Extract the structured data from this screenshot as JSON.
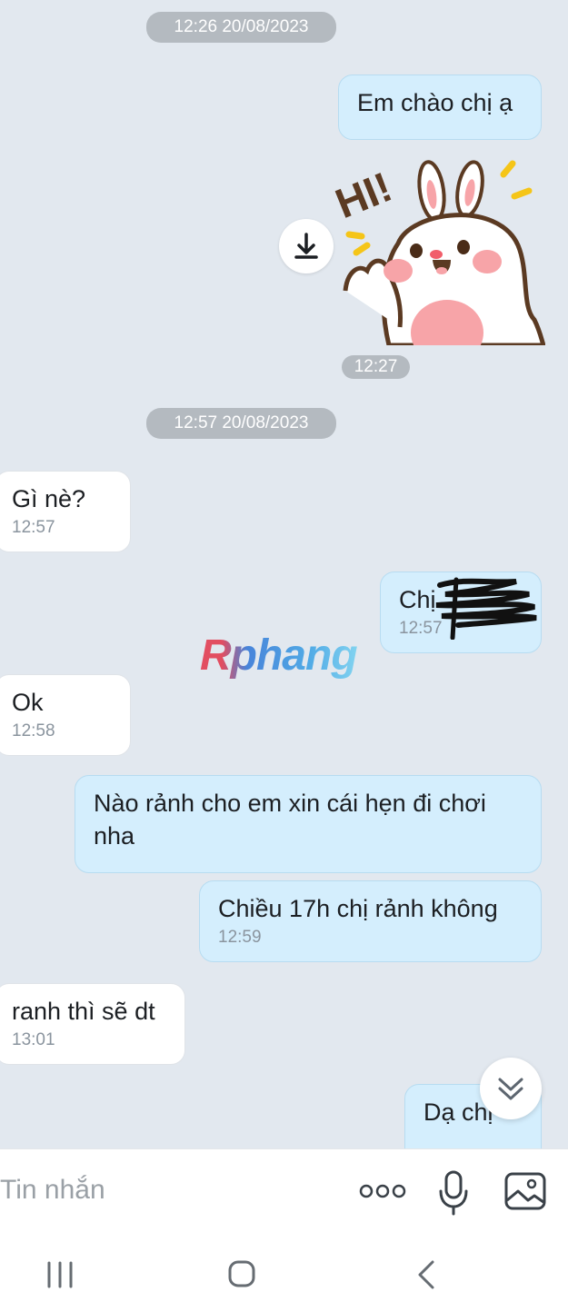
{
  "messages": [
    {
      "type": "date",
      "text": "12:26 20/08/2023"
    },
    {
      "type": "out",
      "text": "Em chào chị ạ"
    },
    {
      "type": "sticker",
      "text": "HI!",
      "time": "12:27"
    },
    {
      "type": "date",
      "text": "12:57 20/08/2023"
    },
    {
      "type": "in",
      "text": "Gì nè?",
      "time": "12:57"
    },
    {
      "type": "out",
      "text": "Chị",
      "time": "12:57"
    },
    {
      "type": "in",
      "text": "Ok",
      "time": "12:58"
    },
    {
      "type": "out",
      "text": "Nào rảnh cho em xin cái hẹn đi chơi nha"
    },
    {
      "type": "out",
      "text": "Chiều 17h chị rảnh không",
      "time": "12:59"
    },
    {
      "type": "in",
      "text": "ranh thì sẽ dt",
      "time": "13:01"
    },
    {
      "type": "out",
      "text": "Dạ chị"
    }
  ],
  "watermark": "Rphang",
  "composer": {
    "placeholder": "Tin nhắn"
  },
  "icons": {
    "download": "download-icon",
    "scroll": "chevron-double-down-icon",
    "more": "more-icon",
    "mic": "mic-icon",
    "image": "image-icon",
    "recents": "recents-icon",
    "home": "home-icon",
    "back": "back-icon"
  },
  "colors": {
    "out_bubble": "#d4eefd",
    "in_bubble": "#ffffff",
    "background": "#e2e8ef",
    "pill": "#b4bac0"
  }
}
